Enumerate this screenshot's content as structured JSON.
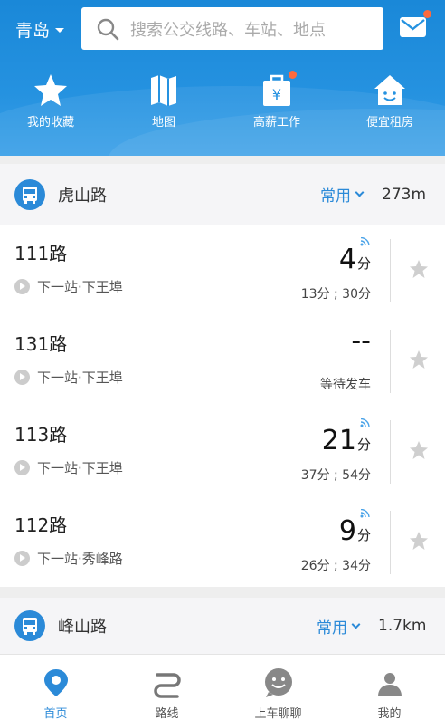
{
  "header": {
    "city": "青岛",
    "search_placeholder": "搜索公交线路、车站、地点",
    "quick_links": [
      {
        "label": "我的收藏",
        "icon": "star-icon"
      },
      {
        "label": "地图",
        "icon": "map-icon"
      },
      {
        "label": "高薪工作",
        "icon": "briefcase-icon"
      },
      {
        "label": "便宜租房",
        "icon": "house-icon"
      }
    ]
  },
  "stations": [
    {
      "name": "虎山路",
      "common_label": "常用",
      "distance": "273m",
      "routes": [
        {
          "name": "111路",
          "next_stop": "下一站·下王埠",
          "eta": "4",
          "unit": "分",
          "times": "13分 ; 30分",
          "realtime": true
        },
        {
          "name": "131路",
          "next_stop": "下一站·下王埠",
          "eta": "--",
          "unit": "",
          "times": "等待发车",
          "realtime": false
        },
        {
          "name": "113路",
          "next_stop": "下一站·下王埠",
          "eta": "21",
          "unit": "分",
          "times": "37分 ; 54分",
          "realtime": true
        },
        {
          "name": "112路",
          "next_stop": "下一站·秀峰路",
          "eta": "9",
          "unit": "分",
          "times": "26分 ; 34分",
          "realtime": true
        }
      ]
    },
    {
      "name": "峰山路",
      "common_label": "常用",
      "distance": "1.7km"
    }
  ],
  "bottom_nav": [
    {
      "label": "首页",
      "icon": "location-pin-icon",
      "active": true
    },
    {
      "label": "路线",
      "icon": "route-icon",
      "active": false
    },
    {
      "label": "上车聊聊",
      "icon": "chat-face-icon",
      "active": false
    },
    {
      "label": "我的",
      "icon": "user-icon",
      "active": false
    }
  ],
  "colors": {
    "primary": "#2592e0",
    "accent": "#2b8ad8",
    "badge": "#ff6a3c"
  }
}
